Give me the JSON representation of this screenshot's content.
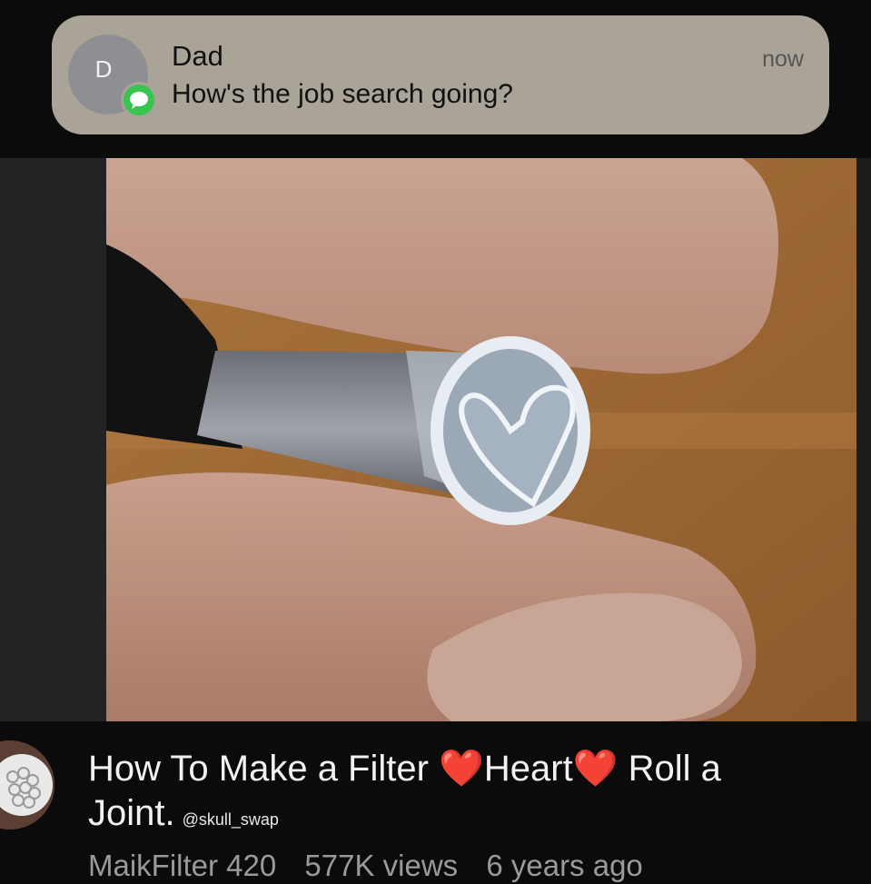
{
  "notification": {
    "avatar_letter": "D",
    "sender": "Dad",
    "message": "How's the job search going?",
    "time": "now",
    "app_icon": "messages-icon"
  },
  "video": {
    "title_part1": "How To Make a Filter ",
    "heart1": "❤️",
    "title_part2": "Heart",
    "heart2": "❤️",
    "title_part3": " Roll a Joint.",
    "handle": "@skull_swap",
    "channel": "MaikFilter 420",
    "views": "577K views",
    "age": "6 years ago"
  },
  "colors": {
    "banner": "#a9a497",
    "messages_green": "#38c54f",
    "background": "#0b0b0b",
    "heart": "#e0262b"
  }
}
